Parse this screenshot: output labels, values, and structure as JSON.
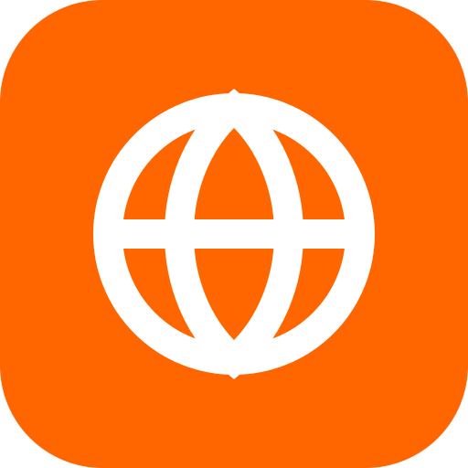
{
  "app_icon": {
    "name": "globe-icon",
    "background_color": "#FF6600",
    "glyph_color": "#FFFFFF"
  }
}
